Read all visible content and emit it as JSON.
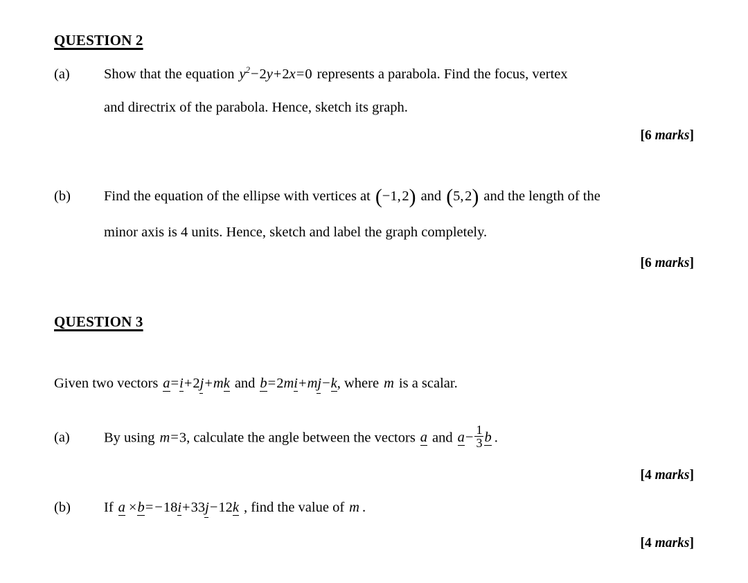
{
  "document": {
    "type": "exam-paper",
    "questions": [
      {
        "heading": "QUESTION 2",
        "parts": [
          {
            "label": "(a)",
            "lines": [
              "Show that the equation  y² − 2y + 2x = 0  represents a parabola. Find the focus, vertex",
              "and directrix of the parabola. Hence, sketch its graph."
            ],
            "marks": "[6 marks]",
            "marks_number": "6",
            "marks_word": "marks",
            "equation": "y² − 2y + 2x = 0"
          },
          {
            "label": "(b)",
            "lines": [
              "Find the equation of the ellipse with vertices at (−1,2) and (5,2) and the length of the",
              "minor axis is 4 units. Hence, sketch and label the graph completely."
            ],
            "marks": "[6 marks]",
            "marks_number": "6",
            "marks_word": "marks",
            "vertex_1": "(−1,2)",
            "vertex_2": "(5,2)",
            "minor_axis_length": "4 units"
          }
        ]
      },
      {
        "heading": "QUESTION 3",
        "intro": "Given two vectors  a = i + 2j + mk  and  b = 2mi + mj − k , where  m  is a scalar.",
        "vector_a": "a = i + 2j + mk",
        "vector_b": "b = 2mi + mj − k",
        "scalar_name": "m",
        "parts": [
          {
            "label": "(a)",
            "lines": [
              "By using m = 3 , calculate the angle between the vectors  a  and  a − (1/3)b ."
            ],
            "marks": "[4 marks]",
            "marks_number": "4",
            "marks_word": "marks",
            "m_value": "3",
            "expression": "a − 1/3 b"
          },
          {
            "label": "(b)",
            "lines": [
              "If  a × b = −18i + 33j − 12k , find the value of  m ."
            ],
            "marks": "[4 marks]",
            "marks_number": "4",
            "marks_word": "marks",
            "cross_product": "a × b = −18i + 33j − 12k"
          }
        ]
      }
    ],
    "text_fragments": {
      "q2a_l1_pre": "Show that the equation",
      "q2a_l1_post": "represents a parabola. Find the focus, vertex",
      "q2a_l2": "and directrix of the parabola. Hence, sketch its graph.",
      "q2b_l1_pre": "Find the equation of the ellipse with vertices at",
      "q2b_l1_mid": "and",
      "q2b_l1_post": "and the length of the",
      "q2b_l2": "minor axis is 4 units. Hence, sketch and label the graph completely.",
      "q3_intro_pre": "Given two vectors",
      "q3_intro_mid": "and",
      "q3_intro_post": ", where",
      "q3_intro_end": "is a scalar.",
      "q3a_pre": "By using",
      "q3a_mid": ", calculate the angle between the vectors",
      "q3a_and": "and",
      "q3b_pre": "If",
      "q3b_post": ", find the value of",
      "q3b_end": "."
    }
  }
}
